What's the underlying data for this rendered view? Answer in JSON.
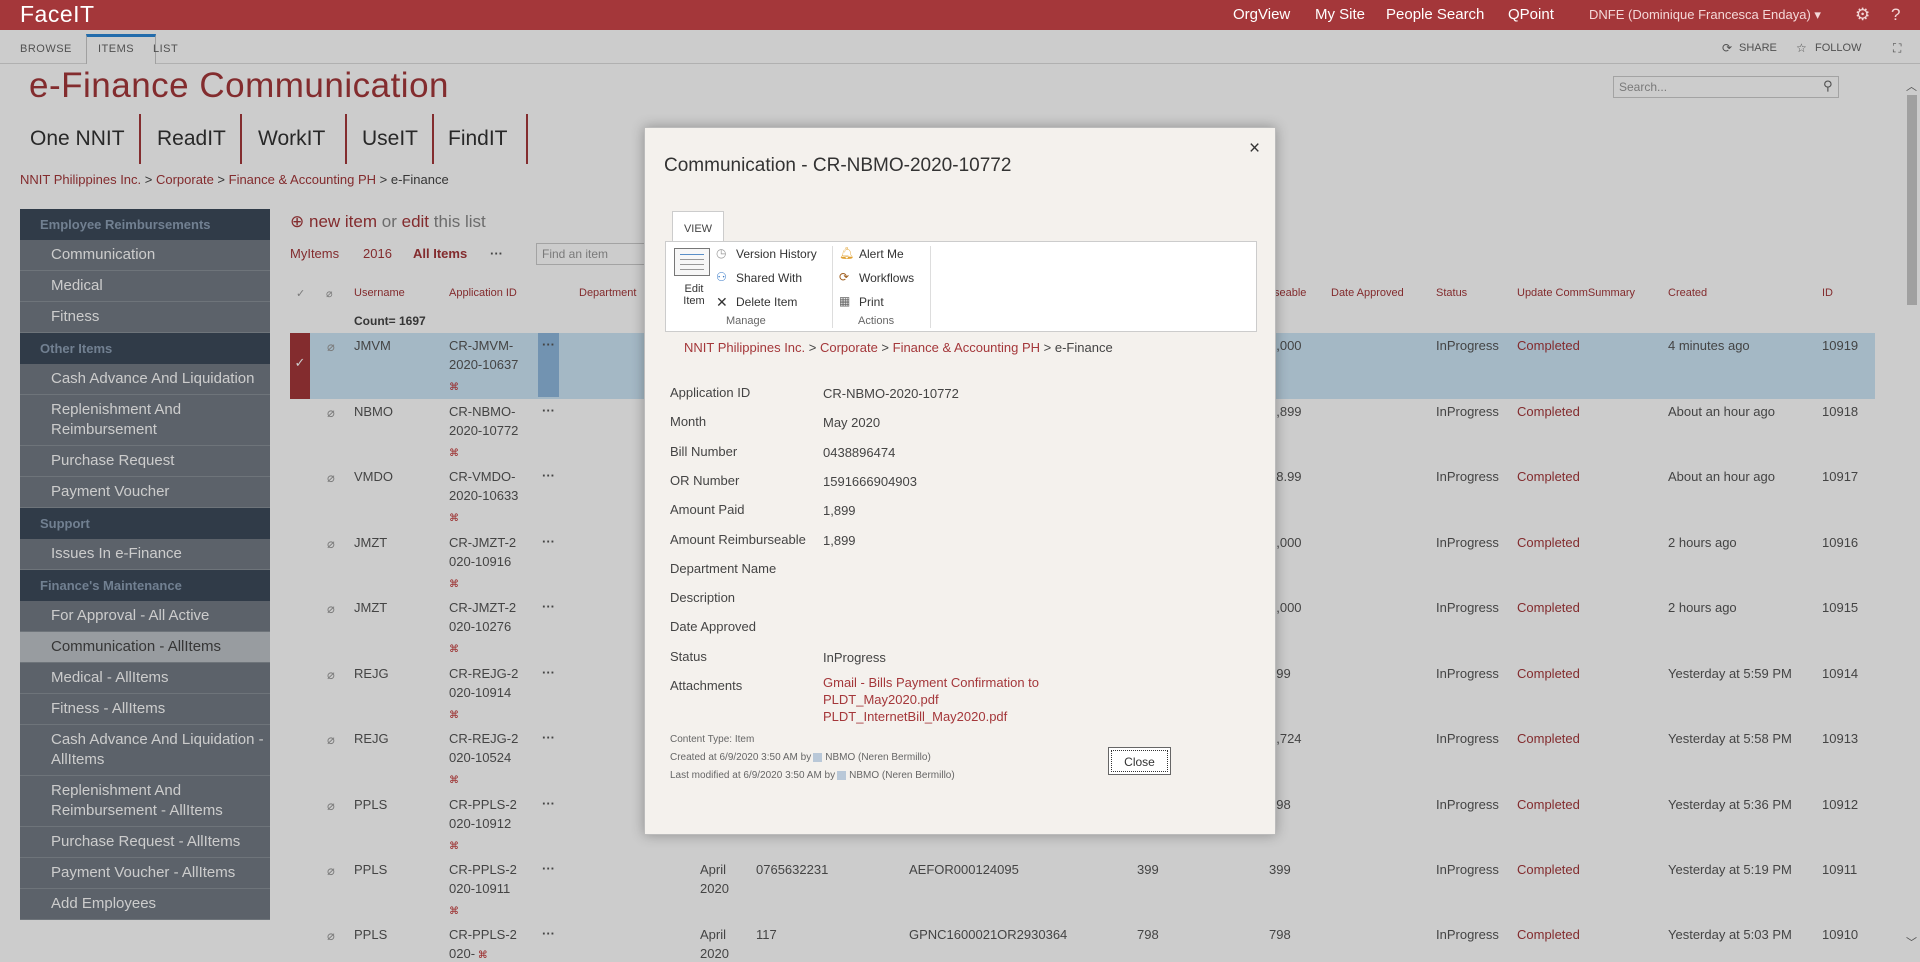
{
  "suitebar": {
    "brand": "FaceIT",
    "links": [
      "OrgView",
      "My Site",
      "People Search",
      "QPoint"
    ],
    "user": "DNFE (Dominique Francesca Endaya) ▾",
    "settings_glyph": "⚙",
    "help_glyph": "?"
  },
  "ribbon": {
    "tabs": [
      "BROWSE",
      "ITEMS",
      "LIST"
    ],
    "share": "SHARE",
    "follow": "FOLLOW"
  },
  "site": {
    "title": "e-Finance Communication",
    "search_placeholder": "Search...",
    "top_nav": [
      "One NNIT",
      "ReadIT",
      "WorkIT",
      "UseIT",
      "FindIT"
    ],
    "breadcrumb": [
      "NNIT Philippines Inc.",
      "Corporate",
      "Finance & Accounting PH",
      "e-Finance"
    ]
  },
  "quicklaunch": {
    "groups": [
      {
        "heading": "Employee Reimbursements",
        "items": [
          "Communication",
          "Medical",
          "Fitness"
        ]
      },
      {
        "heading": "Other Items",
        "items": [
          "Cash Advance And Liquidation",
          "Replenishment And Reimbursement",
          "Purchase Request",
          "Payment Voucher"
        ]
      },
      {
        "heading": "Support",
        "items": [
          "Issues In e-Finance"
        ]
      },
      {
        "heading": "Finance's Maintenance",
        "items": [
          "For Approval - All Active",
          "Communication - AllItems",
          "Medical - AllItems",
          "Fitness - AllItems",
          "Cash Advance And Liquidation - AllItems",
          "Replenishment And Reimbursement - AllItems",
          "Purchase Request - AllItems",
          "Payment Voucher - AllItems",
          "Add Employees"
        ]
      }
    ],
    "selected": "Communication - AllItems"
  },
  "list": {
    "new_item": "new item",
    "or": "or",
    "edit": "edit",
    "this_list": "this list",
    "views": [
      "MyItems",
      "2016",
      "All Items"
    ],
    "find_placeholder": "Find an item",
    "headers": [
      "Username",
      "Application ID",
      "Department",
      "seable",
      "Date Approved",
      "Status",
      "Update CommSummary",
      "Created",
      "ID"
    ],
    "count": "Count= 1697",
    "rows": [
      {
        "user": "JMVM",
        "app_id": "CR-JMVM-2020-10637",
        "month": "",
        "bill": "",
        "or": "",
        "paid": "",
        "reimb": "2,000",
        "status": "InProgress",
        "summary": "Completed",
        "created": "4 minutes ago",
        "id": "10919"
      },
      {
        "user": "NBMO",
        "app_id": "CR-NBMO-2020-10772",
        "month": "",
        "bill": "",
        "or": "",
        "paid": "",
        "reimb": "1,899",
        "status": "InProgress",
        "summary": "Completed",
        "created": "About an hour ago",
        "id": "10918"
      },
      {
        "user": "VMDO",
        "app_id": "CR-VMDO-2020-10633",
        "month": "",
        "bill": "",
        "or": "",
        "paid": "",
        "reimb": "98.99",
        "status": "InProgress",
        "summary": "Completed",
        "created": "About an hour ago",
        "id": "10917"
      },
      {
        "user": "JMZT",
        "app_id": "CR-JMZT-2020-10916",
        "month": "",
        "bill": "",
        "or": "",
        "paid": "",
        "reimb": "2,000",
        "status": "InProgress",
        "summary": "Completed",
        "created": "2 hours ago",
        "id": "10916"
      },
      {
        "user": "JMZT",
        "app_id": "CR-JMZT-2020-10276",
        "month": "",
        "bill": "",
        "or": "",
        "paid": "",
        "reimb": "2,000",
        "status": "InProgress",
        "summary": "Completed",
        "created": "2 hours ago",
        "id": "10915"
      },
      {
        "user": "REJG",
        "app_id": "CR-REJG-2020-10914",
        "month": "",
        "bill": "",
        "or": "",
        "paid": "",
        "reimb": "999",
        "status": "InProgress",
        "summary": "Completed",
        "created": "Yesterday at 5:59 PM",
        "id": "10914"
      },
      {
        "user": "REJG",
        "app_id": "CR-REJG-2020-10524",
        "month": "",
        "bill": "",
        "or": "",
        "paid": "",
        "reimb": "1,724",
        "status": "InProgress",
        "summary": "Completed",
        "created": "Yesterday at 5:58 PM",
        "id": "10913"
      },
      {
        "user": "PPLS",
        "app_id": "CR-PPLS-2020-10912",
        "month": "",
        "bill": "",
        "or": "",
        "paid": "",
        "reimb": "798",
        "status": "InProgress",
        "summary": "Completed",
        "created": "Yesterday at 5:36 PM",
        "id": "10912"
      },
      {
        "user": "PPLS",
        "app_id": "CR-PPLS-2020-10911",
        "month": "April 2020",
        "bill": "0765632231",
        "or": "AEFOR000124095",
        "paid": "399",
        "reimb": "399",
        "status": "InProgress",
        "summary": "Completed",
        "created": "Yesterday at 5:19 PM",
        "id": "10911"
      },
      {
        "user": "PPLS",
        "app_id": "CR-PPLS-2020-",
        "month": "April 2020",
        "bill": "117",
        "or": "GPNC1600021OR2930364",
        "paid": "798",
        "reimb": "798",
        "status": "InProgress",
        "summary": "Completed",
        "created": "Yesterday at 5:03 PM",
        "id": "10910"
      }
    ]
  },
  "dialog": {
    "title": "Communication - CR-NBMO-2020-10772",
    "close_glyph": "×",
    "tab": "VIEW",
    "ribbon": {
      "edit_item": "Edit Item",
      "version_history": "Version History",
      "shared_with": "Shared With",
      "delete_item": "Delete Item",
      "manage": "Manage",
      "alert_me": "Alert Me",
      "workflows": "Workflows",
      "print": "Print",
      "actions": "Actions"
    },
    "breadcrumb": [
      "NNIT Philippines Inc.",
      "Corporate",
      "Finance & Accounting PH",
      "e-Finance"
    ],
    "fields": [
      {
        "label": "Application ID",
        "value": "CR-NBMO-2020-10772"
      },
      {
        "label": "Month",
        "value": "May 2020"
      },
      {
        "label": "Bill Number",
        "value": "0438896474"
      },
      {
        "label": "OR Number",
        "value": "1591666904903"
      },
      {
        "label": "Amount Paid",
        "value": "1,899"
      },
      {
        "label": "Amount Reimburseable",
        "value": "1,899"
      },
      {
        "label": "Department Name",
        "value": ""
      },
      {
        "label": "Description",
        "value": ""
      },
      {
        "label": "Date Approved",
        "value": ""
      },
      {
        "label": "Status",
        "value": "InProgress"
      },
      {
        "label": "Attachments",
        "value": ""
      }
    ],
    "attachments": [
      "Gmail - Bills Payment Confirmation to PLDT_May2020.pdf",
      "PLDT_InternetBill_May2020.pdf"
    ],
    "content_type": "Content Type: Item",
    "created": "Created at 6/9/2020 3:50 AM  by",
    "created_by": "NBMO (Neren Bermillo)",
    "modified": "Last modified at 6/9/2020 3:50 AM  by",
    "modified_by": "NBMO (Neren Bermillo)",
    "close_button": "Close"
  },
  "colors": {
    "accent": "#a4373a",
    "selected_row": "#cde6f7",
    "nav_bg": "#737b85",
    "nav_head": "#3d4a5a"
  }
}
